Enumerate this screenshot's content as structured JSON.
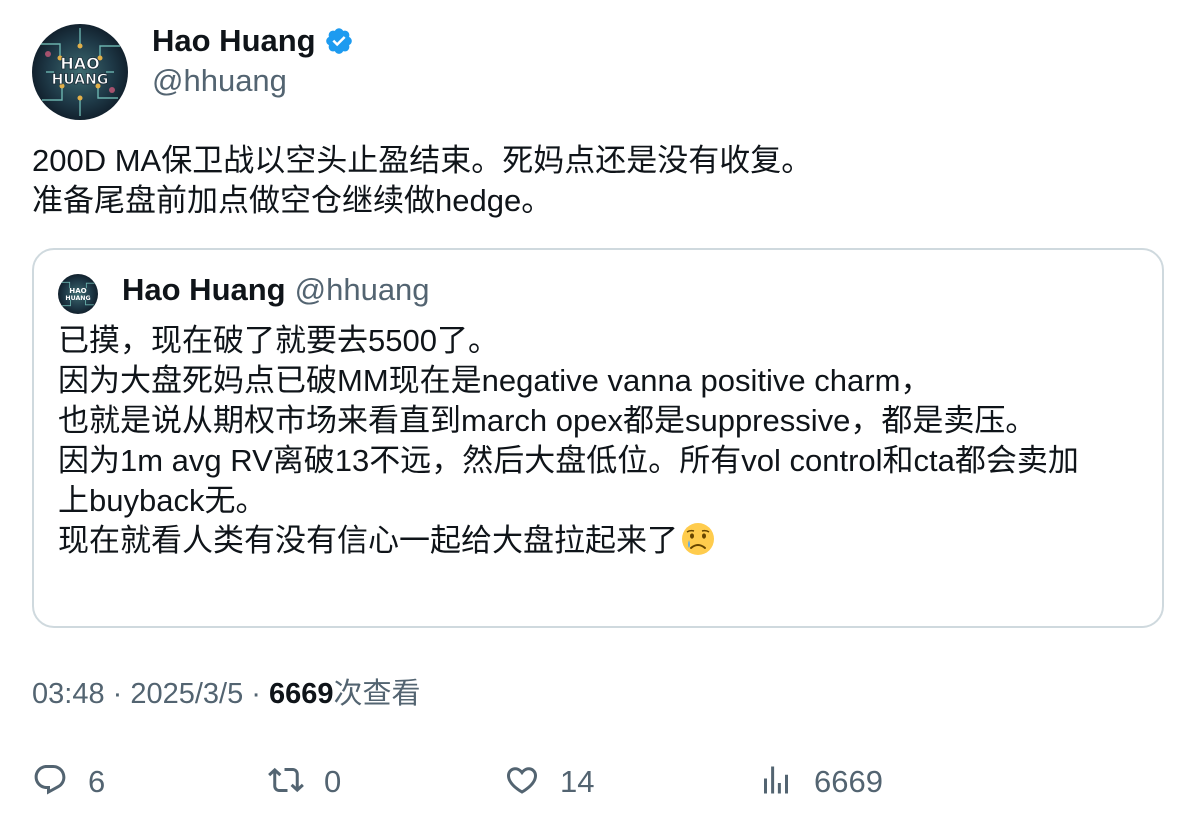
{
  "author": {
    "name": "Hao Huang",
    "handle": "@hhuang",
    "avatar_text_line1": "HAO",
    "avatar_text_line2": "HUANG",
    "verified_icon": "verified-badge-icon"
  },
  "tweet": {
    "lines": [
      "200D MA保卫战以空头止盈结束。死妈点还是没有收复。",
      "准备尾盘前加点做空仓继续做hedge。"
    ]
  },
  "quote": {
    "name": "Hao Huang",
    "handle": "@hhuang",
    "lines": [
      "已摸，现在破了就要去5500了。",
      "因为大盘死妈点已破MM现在是negative vanna positive charm，",
      "也就是说从期权市场来看直到march opex都是suppressive，都是卖压。",
      "因为1m avg RV离破13不远，然后大盘低位。所有vol control和cta都会卖加",
      "上buyback无。"
    ],
    "last_line": "现在就看人类有没有信心一起给大盘拉起来了",
    "emoji": "😢"
  },
  "meta": {
    "time": "03:48",
    "sep1": " · ",
    "date": "2025/3/5",
    "sep2": " · ",
    "views": "6669",
    "views_suffix": "次查看"
  },
  "actions": {
    "reply_count": "6",
    "retweet_count": "0",
    "like_count": "14",
    "views_count": "6669"
  },
  "colors": {
    "primary_text": "#0f1419",
    "secondary_text": "#536471",
    "border": "#cfd9de",
    "verified": "#1d9bf0"
  }
}
